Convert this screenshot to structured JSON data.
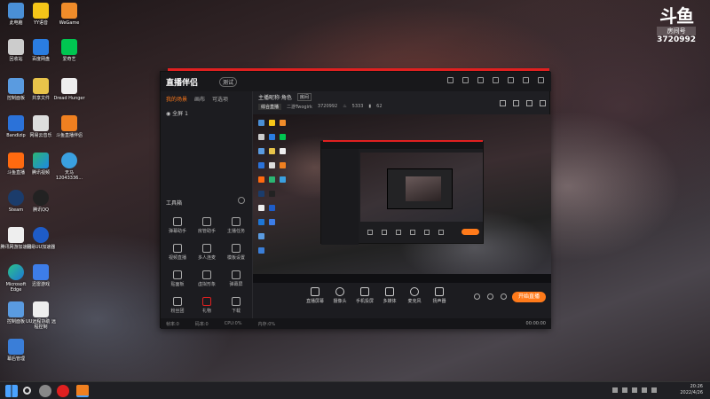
{
  "desktop": {
    "icons": [
      {
        "label": "此电脑"
      },
      {
        "label": "YY语音"
      },
      {
        "label": "WeGame"
      },
      {
        "label": "回收站"
      },
      {
        "label": "百度网盘"
      },
      {
        "label": "爱奇艺"
      },
      {
        "label": "控制面板"
      },
      {
        "label": "共享文件"
      },
      {
        "label": "Dread Hunger"
      },
      {
        "label": "Bandizip"
      },
      {
        "label": "网易云音乐"
      },
      {
        "label": "斗鱼直播伴侣"
      },
      {
        "label": "斗鱼直播"
      },
      {
        "label": "腾讯视频"
      },
      {
        "label": "天马 12043336..."
      },
      {
        "label": "Steam"
      },
      {
        "label": "腾讯QQ"
      },
      {
        "label": "腾讯网游加速器"
      },
      {
        "label": "网易UU加速器"
      },
      {
        "label": "Microsoft Edge"
      },
      {
        "label": "迅雷游戏"
      },
      {
        "label": "控制面板"
      },
      {
        "label": "UU远程协助 远程控制"
      },
      {
        "label": "幕后管理"
      }
    ]
  },
  "watermark": {
    "logo": "斗鱼",
    "room_label": "房间号",
    "room_number": "3720992"
  },
  "app": {
    "brand": "直播伴侣",
    "beta": "测试",
    "sidebar": {
      "tabs": [
        "我的场景",
        "画布",
        "可选项"
      ],
      "scene": "全屏 1",
      "tools_title": "工具箱",
      "tools": [
        {
          "label": "弹幕助手"
        },
        {
          "label": "房管助手"
        },
        {
          "label": "主播任务"
        },
        {
          "label": "视频直播"
        },
        {
          "label": "多人连麦"
        },
        {
          "label": "模板设置"
        },
        {
          "label": "贴面板"
        },
        {
          "label": "虚拟形象"
        },
        {
          "label": "弹幕屏"
        },
        {
          "label": "粉丝团"
        },
        {
          "label": "礼物"
        },
        {
          "label": "下载"
        }
      ]
    },
    "main": {
      "title": "主播昵称·角色",
      "pill": "房间",
      "category": "综合直播",
      "sub_game": "二游Twogirk",
      "room_id": "3720992",
      "hot": "5333",
      "fans": "62"
    },
    "controls": [
      {
        "label": "直播屏幕"
      },
      {
        "label": "摄像头"
      },
      {
        "label": "手机投屏"
      },
      {
        "label": "多媒体"
      },
      {
        "label": "麦克风"
      },
      {
        "label": "扬声器"
      }
    ],
    "live_button": "开始直播",
    "status": {
      "items": [
        "帧率:0",
        "码率:0",
        "CPU:0%",
        "内存:0%"
      ],
      "timer": "00:00:00"
    }
  },
  "taskbar": {
    "time": "20:26",
    "date": "2022/4/26"
  },
  "colors": {
    "accent": "#ff7a1a",
    "brand_red": "#e02020"
  }
}
